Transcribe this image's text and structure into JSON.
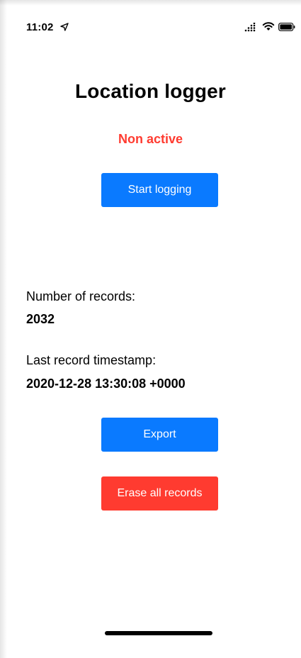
{
  "status_bar": {
    "time": "11:02",
    "icons": [
      "location-arrow-icon",
      "cellular-signal-icon",
      "wifi-icon",
      "battery-icon"
    ]
  },
  "app": {
    "title": "Location logger",
    "logging_status": "Non active",
    "start_button_label": "Start logging",
    "records_label": "Number of records:",
    "records_count": "2032",
    "timestamp_label": "Last record timestamp:",
    "timestamp_value": "2020-12-28 13:30:08 +0000",
    "export_button_label": "Export",
    "erase_button_label": "Erase all records"
  },
  "colors": {
    "accent_blue": "#0a7aff",
    "destructive_red": "#ff3b30",
    "text": "#000000",
    "background": "#ffffff"
  }
}
